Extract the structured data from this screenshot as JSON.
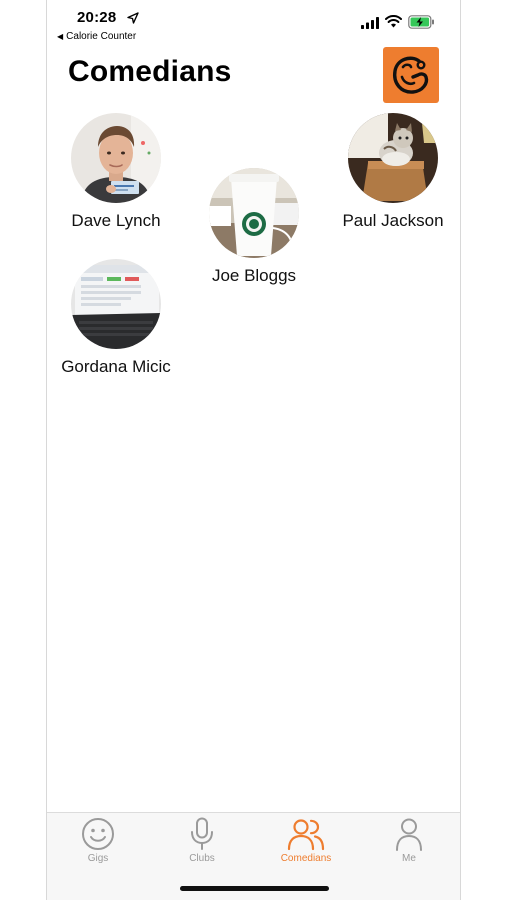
{
  "status_bar": {
    "time": "20:28",
    "back_label": "Calorie Counter"
  },
  "header": {
    "title": "Comedians"
  },
  "colors": {
    "accent": "#ee7d2f",
    "tab_inactive": "#9a9a9a"
  },
  "comedians": [
    {
      "name": "Dave Lynch",
      "avatar": "man-with-card-photo"
    },
    {
      "name": "Joe Bloggs",
      "avatar": "coffee-cup-photo"
    },
    {
      "name": "Paul Jackson",
      "avatar": "cat-photo"
    },
    {
      "name": "Gordana Micic",
      "avatar": "laptop-photo"
    }
  ],
  "tab_bar": {
    "tabs": [
      {
        "label": "Gigs",
        "icon": "smiley-icon",
        "active": false
      },
      {
        "label": "Clubs",
        "icon": "microphone-icon",
        "active": false
      },
      {
        "label": "Comedians",
        "icon": "people-icon",
        "active": true
      },
      {
        "label": "Me",
        "icon": "person-icon",
        "active": false
      }
    ]
  }
}
